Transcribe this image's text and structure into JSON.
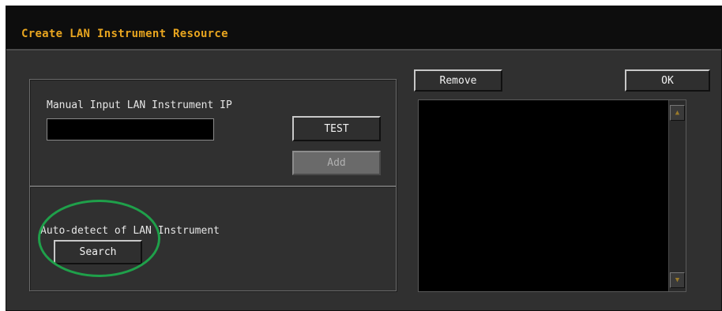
{
  "window": {
    "title": "Create LAN Instrument Resource"
  },
  "manual": {
    "label": "Manual Input LAN Instrument IP",
    "ip_value": "",
    "test_label": "TEST",
    "add_label": "Add"
  },
  "auto": {
    "label": "Auto-detect of LAN Instrument",
    "search_label": "Search"
  },
  "resource_list": {
    "remove_label": "Remove",
    "ok_label": "OK",
    "items": []
  },
  "icons": {
    "scroll_up": "triangle-up-icon",
    "scroll_down": "triangle-down-icon"
  },
  "colors": {
    "title_text": "#e8a51f",
    "window_bg": "#303030",
    "annotation_circle": "#1fa04a"
  }
}
